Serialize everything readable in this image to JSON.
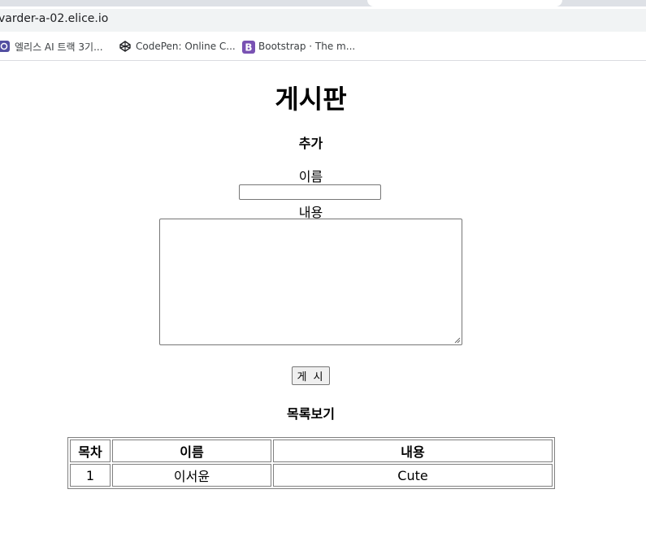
{
  "browser": {
    "url": "varder-a-02.elice.io",
    "bookmarks": [
      {
        "label": "엘리스 AI 트랙 3기...",
        "icon": "elice-icon"
      },
      {
        "label": "CodePen: Online C...",
        "icon": "codepen-icon"
      },
      {
        "label": "Bootstrap · The m...",
        "icon": "bootstrap-icon"
      }
    ]
  },
  "page": {
    "title": "게시판",
    "add_section": "추가",
    "name_label": "이름",
    "content_label": "내용",
    "post_button": "게 시",
    "list_section": "목록보기"
  },
  "table": {
    "headers": [
      "목차",
      "이름",
      "내용"
    ],
    "rows": [
      [
        "1",
        "이서윤",
        "Cute"
      ]
    ]
  },
  "colors": {
    "bootstrap": "#7952b3",
    "elice": "#524fa1"
  }
}
